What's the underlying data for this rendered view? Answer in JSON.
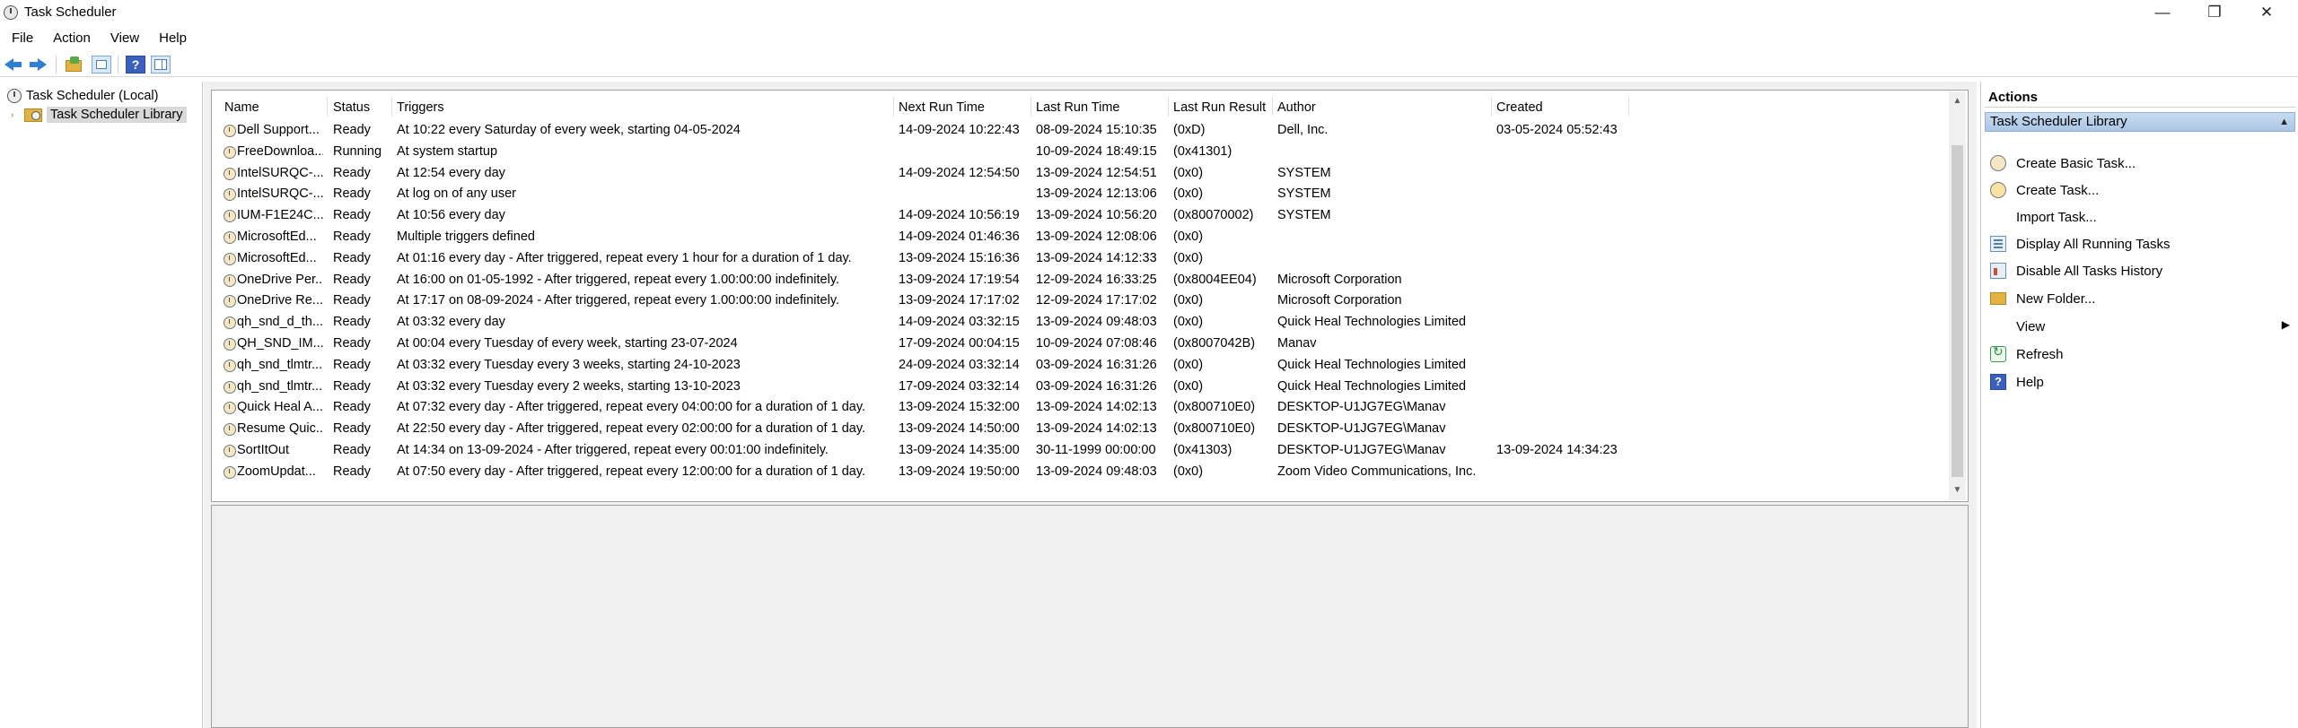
{
  "window": {
    "title": "Task Scheduler",
    "controls": {
      "minimize": "—",
      "maximize": "❐",
      "close": "✕"
    }
  },
  "menu": [
    "File",
    "Action",
    "View",
    "Help"
  ],
  "toolbar": {
    "back": "back-icon",
    "forward": "forward-icon",
    "up_folder": "folder-up-icon",
    "properties": "properties-icon",
    "help": "?",
    "show_hide_pane": "panel-icon"
  },
  "tree": {
    "root": "Task Scheduler (Local)",
    "child": "Task Scheduler Library",
    "expander": "›"
  },
  "task_list": {
    "columns": [
      "Name",
      "Status",
      "Triggers",
      "Next Run Time",
      "Last Run Time",
      "Last Run Result",
      "Author",
      "Created"
    ],
    "rows": [
      [
        "Dell Support...",
        "Ready",
        "At 10:22 every Saturday of every week, starting 04-05-2024",
        "14-09-2024 10:22:43",
        "08-09-2024 15:10:35",
        "(0xD)",
        "Dell, Inc.",
        "03-05-2024 05:52:43"
      ],
      [
        "FreeDownloa...",
        "Running",
        "At system startup",
        "",
        "10-09-2024 18:49:15",
        "(0x41301)",
        "",
        ""
      ],
      [
        "IntelSURQC-...",
        "Ready",
        "At 12:54 every day",
        "14-09-2024 12:54:50",
        "13-09-2024 12:54:51",
        "(0x0)",
        "SYSTEM",
        ""
      ],
      [
        "IntelSURQC-...",
        "Ready",
        "At log on of any user",
        "",
        "13-09-2024 12:13:06",
        "(0x0)",
        "SYSTEM",
        ""
      ],
      [
        "IUM-F1E24C...",
        "Ready",
        "At 10:56 every day",
        "14-09-2024 10:56:19",
        "13-09-2024 10:56:20",
        "(0x80070002)",
        "SYSTEM",
        ""
      ],
      [
        "MicrosoftEd...",
        "Ready",
        "Multiple triggers defined",
        "14-09-2024 01:46:36",
        "13-09-2024 12:08:06",
        "(0x0)",
        "",
        ""
      ],
      [
        "MicrosoftEd...",
        "Ready",
        "At 01:16 every day - After triggered, repeat every 1 hour for a duration of 1 day.",
        "13-09-2024 15:16:36",
        "13-09-2024 14:12:33",
        "(0x0)",
        "",
        ""
      ],
      [
        "OneDrive Per...",
        "Ready",
        "At 16:00 on 01-05-1992 - After triggered, repeat every 1.00:00:00 indefinitely.",
        "13-09-2024 17:19:54",
        "12-09-2024 16:33:25",
        "(0x8004EE04)",
        "Microsoft Corporation",
        ""
      ],
      [
        "OneDrive Re...",
        "Ready",
        "At 17:17 on 08-09-2024 - After triggered, repeat every 1.00:00:00 indefinitely.",
        "13-09-2024 17:17:02",
        "12-09-2024 17:17:02",
        "(0x0)",
        "Microsoft Corporation",
        ""
      ],
      [
        "qh_snd_d_th...",
        "Ready",
        "At 03:32 every day",
        "14-09-2024 03:32:15",
        "13-09-2024 09:48:03",
        "(0x0)",
        "Quick Heal Technologies Limited",
        ""
      ],
      [
        "QH_SND_IM...",
        "Ready",
        "At 00:04 every Tuesday of every week, starting 23-07-2024",
        "17-09-2024 00:04:15",
        "10-09-2024 07:08:46",
        "(0x8007042B)",
        "Manav",
        ""
      ],
      [
        "qh_snd_tlmtr...",
        "Ready",
        "At 03:32 every Tuesday every 3 weeks, starting 24-10-2023",
        "24-09-2024 03:32:14",
        "03-09-2024 16:31:26",
        "(0x0)",
        "Quick Heal Technologies Limited",
        ""
      ],
      [
        "qh_snd_tlmtr...",
        "Ready",
        "At 03:32 every Tuesday every 2 weeks, starting 13-10-2023",
        "17-09-2024 03:32:14",
        "03-09-2024 16:31:26",
        "(0x0)",
        "Quick Heal Technologies Limited",
        ""
      ],
      [
        "Quick Heal A...",
        "Ready",
        "At 07:32 every day - After triggered, repeat every 04:00:00 for a duration of 1 day.",
        "13-09-2024 15:32:00",
        "13-09-2024 14:02:13",
        "(0x800710E0)",
        "DESKTOP-U1JG7EG\\Manav",
        ""
      ],
      [
        "Resume Quic...",
        "Ready",
        "At 22:50 every day - After triggered, repeat every 02:00:00 for a duration of 1 day.",
        "13-09-2024 14:50:00",
        "13-09-2024 14:02:13",
        "(0x800710E0)",
        "DESKTOP-U1JG7EG\\Manav",
        ""
      ],
      [
        "SortItOut",
        "Ready",
        "At 14:34 on 13-09-2024 - After triggered, repeat every 00:01:00 indefinitely.",
        "13-09-2024 14:35:00",
        "30-11-1999 00:00:00",
        "(0x41303)",
        "DESKTOP-U1JG7EG\\Manav",
        "13-09-2024 14:34:23"
      ],
      [
        "ZoomUpdat...",
        "Ready",
        "At 07:50 every day - After triggered, repeat every 12:00:00 for a duration of 1 day.",
        "13-09-2024 19:50:00",
        "13-09-2024 09:48:03",
        "(0x0)",
        "Zoom Video Communications, Inc.",
        ""
      ]
    ]
  },
  "actions": {
    "title": "Actions",
    "section": "Task Scheduler Library",
    "items": [
      {
        "label": "Create Basic Task...",
        "icon": "create-basic-task-icon"
      },
      {
        "label": "Create Task...",
        "icon": "create-task-icon"
      },
      {
        "label": "Import Task...",
        "icon": ""
      },
      {
        "label": "Display All Running Tasks",
        "icon": "running-tasks-icon"
      },
      {
        "label": "Disable All Tasks History",
        "icon": "history-icon"
      },
      {
        "label": "New Folder...",
        "icon": "folder-icon"
      },
      {
        "label": "View",
        "icon": "",
        "submenu": "▶"
      },
      {
        "label": "Refresh",
        "icon": "refresh-icon"
      },
      {
        "label": "Help",
        "icon": "help-icon"
      }
    ]
  }
}
